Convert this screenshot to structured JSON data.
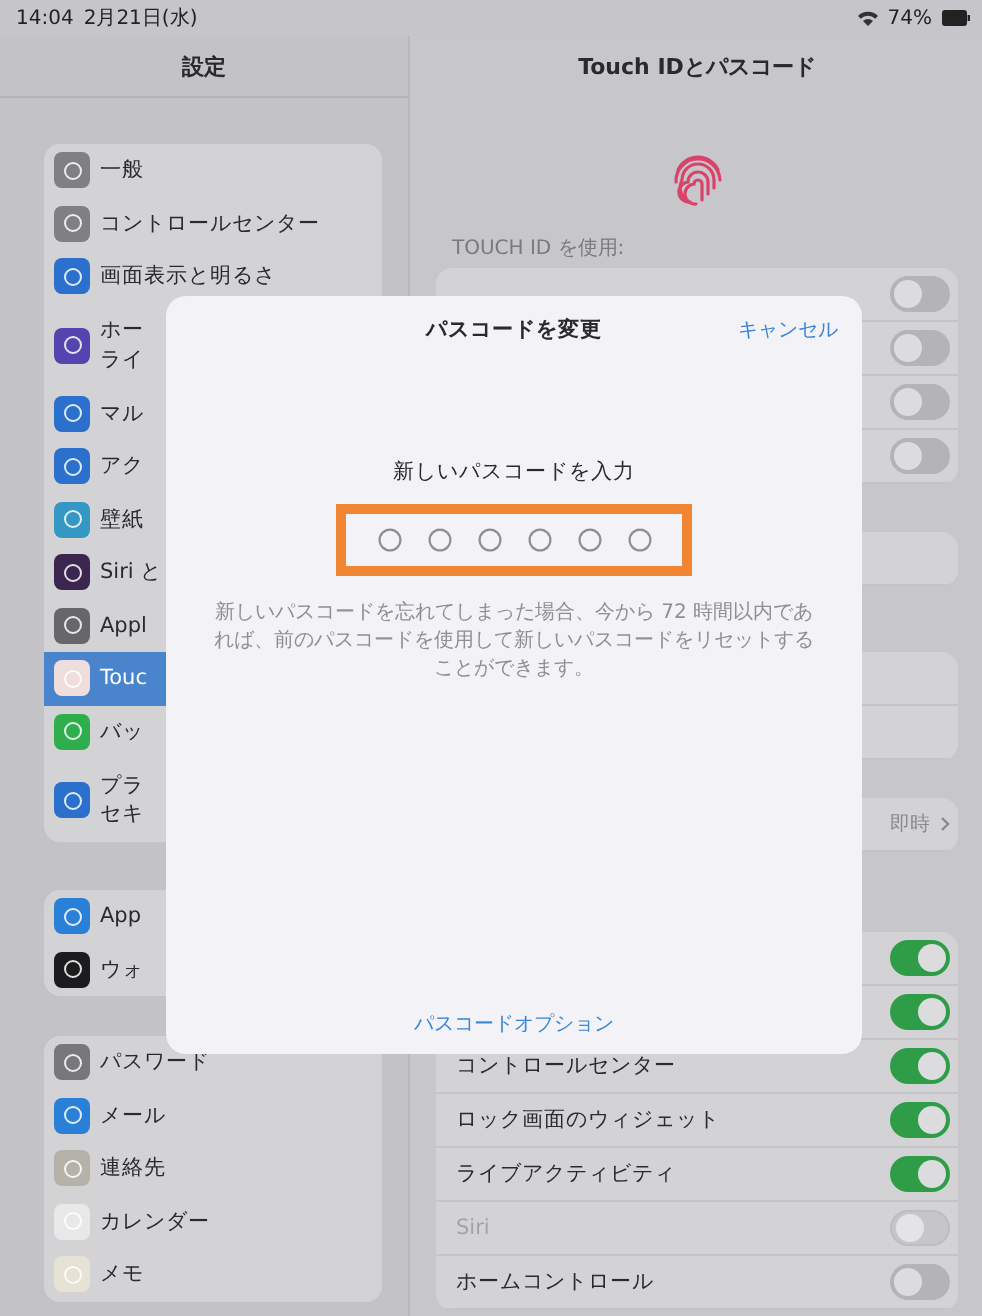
{
  "status_bar": {
    "time": "14:04",
    "date": "2月21日(水)",
    "battery": "74%"
  },
  "sidebar": {
    "title": "設定",
    "groups": [
      {
        "items": [
          {
            "label": "一般",
            "color": "#7f7f84",
            "selected": false
          },
          {
            "label": "コントロールセンター",
            "color": "#7f7f84",
            "selected": false
          },
          {
            "label": "画面表示と明るさ",
            "color": "#2a70cc",
            "selected": false
          },
          {
            "lines": [
              "ホー",
              "ライ"
            ],
            "color": "#5444b0",
            "selected": false
          },
          {
            "label": "マル",
            "color": "#2a70cc",
            "selected": false
          },
          {
            "label": "アク",
            "color": "#2a70cc",
            "selected": false
          },
          {
            "label": "壁紙",
            "color": "#3598c4",
            "selected": false
          },
          {
            "label": "Siri と",
            "color": "#3b2650",
            "selected": false
          },
          {
            "label": "Appl",
            "color": "#67676b",
            "selected": false
          },
          {
            "label": "Touc",
            "color": "#f0dede",
            "selected": true
          },
          {
            "label": "バッ",
            "color": "#2fae4e",
            "selected": false
          },
          {
            "lines": [
              "プラ",
              "セキ"
            ],
            "color": "#2a70cc",
            "selected": false
          }
        ]
      },
      {
        "items": [
          {
            "label": "App",
            "color": "#2a7fd6",
            "selected": false
          },
          {
            "label": "ウォ",
            "color": "#1c1c1e",
            "selected": false
          }
        ]
      },
      {
        "items": [
          {
            "label": "パスワード",
            "color": "#77777c",
            "selected": false
          },
          {
            "label": "メール",
            "color": "#2a7fd6",
            "selected": false
          },
          {
            "label": "連絡先",
            "color": "#b5b2aa",
            "selected": false
          },
          {
            "label": "カレンダー",
            "color": "#e8e8e8",
            "selected": false
          },
          {
            "label": "メモ",
            "color": "#e6e2d6",
            "selected": false
          }
        ]
      }
    ]
  },
  "detail": {
    "title": "Touch IDとパスコード",
    "groups": [
      {
        "label": "TOUCH ID を使用:",
        "rows": [
          {
            "kind": "toggle",
            "on": false,
            "disabled": false
          },
          {
            "kind": "toggle",
            "on": false,
            "disabled": false
          },
          {
            "kind": "toggle",
            "on": false,
            "disabled": false
          },
          {
            "kind": "toggle",
            "on": false,
            "disabled": false
          }
        ]
      },
      {
        "rows": [
          {
            "kind": "blank"
          }
        ]
      },
      {
        "rows": [
          {
            "kind": "blank"
          },
          {
            "kind": "blank"
          }
        ]
      },
      {
        "rows": [
          {
            "kind": "value",
            "value": "即時"
          }
        ]
      },
      {
        "rows": [
          {
            "kind": "toggle",
            "on": true,
            "disabled": false
          },
          {
            "kind": "toggle",
            "on": true,
            "disabled": false
          },
          {
            "kind": "toggle",
            "label": "コントロールセンター",
            "on": true,
            "disabled": false
          },
          {
            "kind": "toggle",
            "label": "ロック画面のウィジェット",
            "on": true,
            "disabled": false
          },
          {
            "kind": "toggle",
            "label": "ライブアクティビティ",
            "on": true,
            "disabled": false
          },
          {
            "kind": "toggle",
            "label": "Siri",
            "on": false,
            "disabled": true
          },
          {
            "kind": "toggle",
            "label": "ホームコントロール",
            "on": false,
            "disabled": false
          }
        ]
      }
    ]
  },
  "dialog": {
    "title": "パスコードを変更",
    "cancel": "キャンセル",
    "prompt": "新しいパスコードを入力",
    "passcode": {
      "highlighted": true,
      "digits": [
        {
          "filled": false
        },
        {
          "filled": false
        },
        {
          "filled": false
        },
        {
          "filled": false
        },
        {
          "filled": false
        },
        {
          "filled": false
        }
      ]
    },
    "hint": "新しいパスコードを忘れてしまった場合、今から 72 時間以内であれば、前のパスコードを使用して新しいパスコードをリセットすることができます。",
    "options": "パスコードオプション"
  }
}
